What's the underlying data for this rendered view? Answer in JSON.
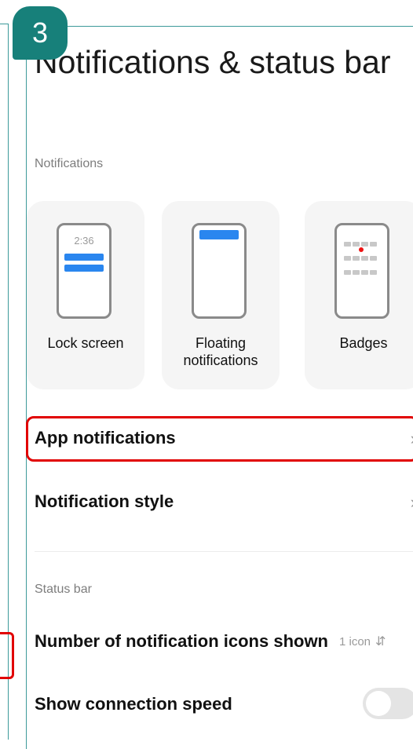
{
  "step_number": "3",
  "title": "Notifications & status bar",
  "notifications_section": "Notifications",
  "cards": [
    {
      "label": "Lock screen",
      "time": "2:36",
      "icon": "lock-screen-preview-icon"
    },
    {
      "label": "Floating notifications",
      "icon": "floating-notification-preview-icon"
    },
    {
      "label": "Badges",
      "icon": "badges-preview-icon"
    }
  ],
  "rows": {
    "app_notifications": "App notifications",
    "notification_style": "Notification style"
  },
  "status_bar_section": "Status bar",
  "notification_icons": {
    "label": "Number of notification icons shown",
    "value": "1 icon"
  },
  "connection_speed": {
    "label": "Show connection speed",
    "enabled": false
  },
  "colors": {
    "accent": "#17807a",
    "highlight": "#e10000",
    "blue": "#2a86ef"
  }
}
